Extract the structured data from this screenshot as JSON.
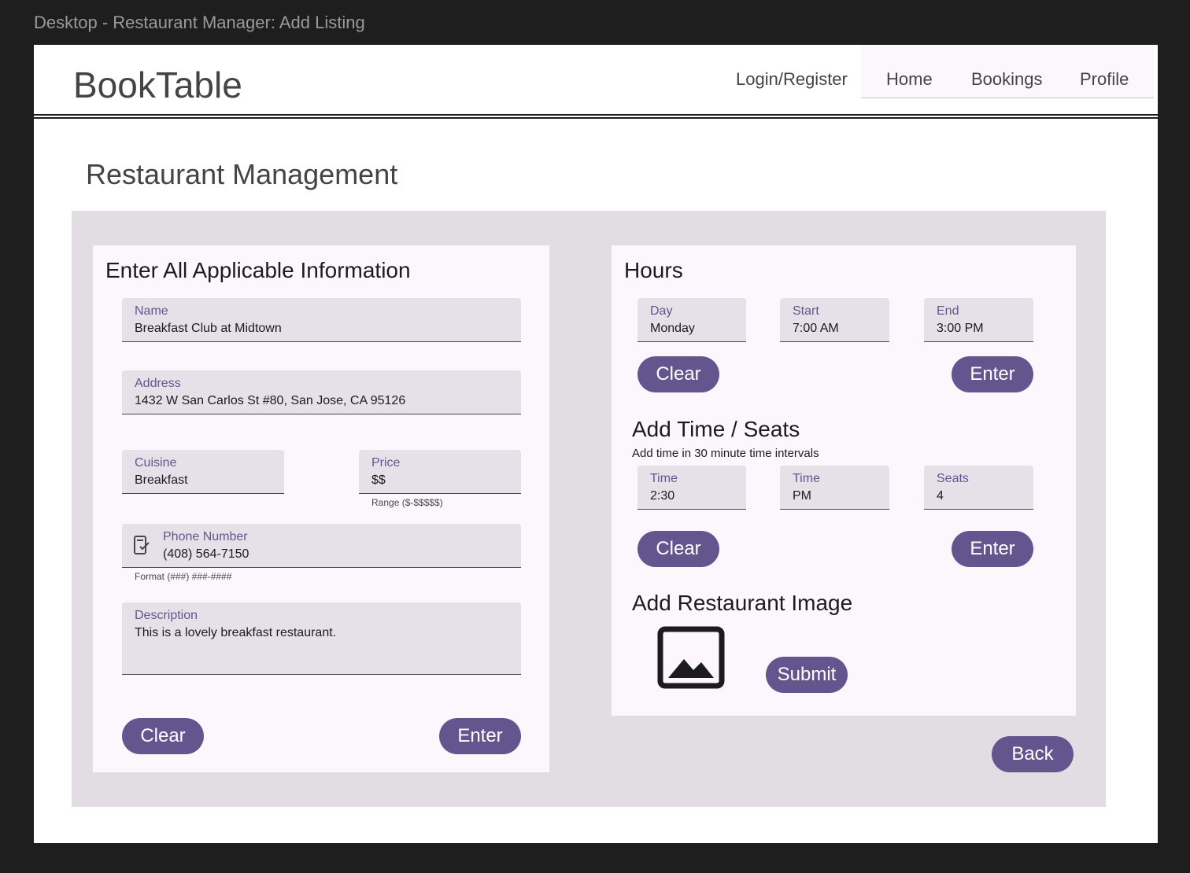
{
  "canvas_title": "Desktop - Restaurant Manager: Add Listing",
  "header": {
    "brand": "BookTable",
    "login_link": "Login/Register",
    "nav": [
      "Home",
      "Bookings",
      "Profile"
    ]
  },
  "page_title": "Restaurant Management",
  "info_card": {
    "heading": "Enter All Applicable Information",
    "name": {
      "label": "Name",
      "value": "Breakfast Club at Midtown"
    },
    "address": {
      "label": "Address",
      "value": "1432 W San Carlos St #80, San Jose, CA 95126"
    },
    "cuisine": {
      "label": "Cuisine",
      "value": "Breakfast"
    },
    "price": {
      "label": "Price",
      "value": "$$",
      "helper": "Range ($-$$$$$)"
    },
    "phone": {
      "label": "Phone Number",
      "value": "(408) 564-7150",
      "helper": "Format (###) ###-####"
    },
    "description": {
      "label": "Description",
      "value": "This is a lovely breakfast restaurant."
    },
    "clear_label": "Clear",
    "enter_label": "Enter"
  },
  "hours_card": {
    "heading": "Hours",
    "day": {
      "label": "Day",
      "value": "Monday"
    },
    "start": {
      "label": "Start",
      "value": "7:00 AM"
    },
    "end": {
      "label": "End",
      "value": "3:00 PM"
    },
    "clear_label": "Clear",
    "enter_label": "Enter",
    "seats_heading": "Add Time / Seats",
    "seats_note": "Add time in 30 minute time intervals",
    "time": {
      "label": "Time",
      "value": "2:30"
    },
    "ampm": {
      "label": "Time",
      "value": "PM"
    },
    "seats": {
      "label": "Seats",
      "value": "4"
    },
    "seats_clear_label": "Clear",
    "seats_enter_label": "Enter",
    "image_heading": "Add Restaurant Image",
    "submit_label": "Submit"
  },
  "back_label": "Back",
  "colors": {
    "accent": "#65558f",
    "card_bg": "#fcf6fd",
    "panel_bg": "#e1dde3",
    "field_bg": "#e6e0e9"
  },
  "icons": [
    "phone-check-icon",
    "image-placeholder-icon"
  ]
}
